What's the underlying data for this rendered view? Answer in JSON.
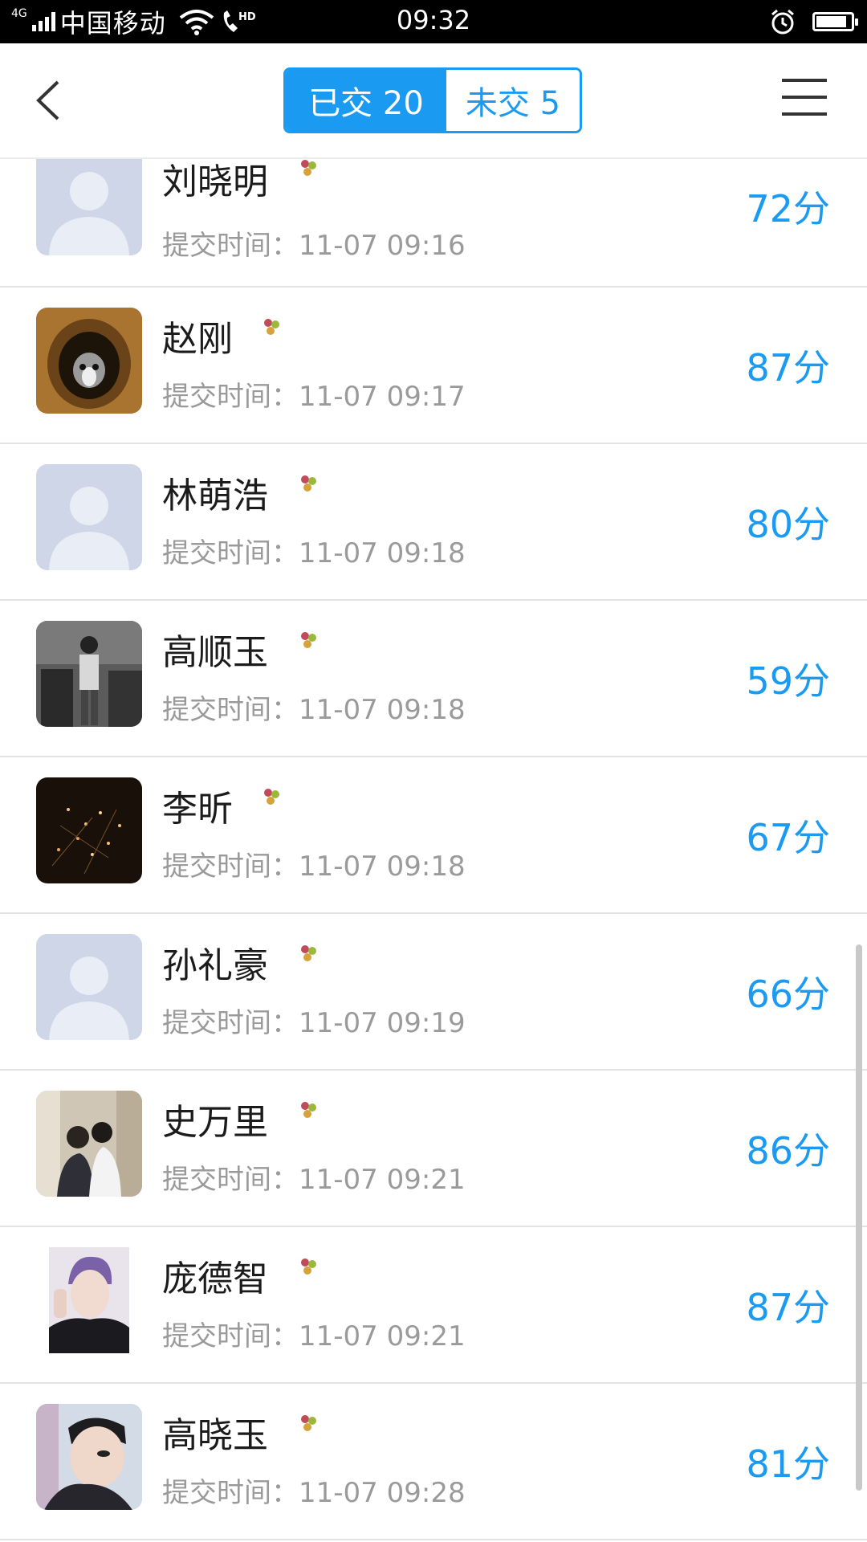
{
  "status_bar": {
    "network": "4G",
    "carrier": "中国移动",
    "time": "09:32"
  },
  "header": {
    "tabs": [
      {
        "label": "已交 20",
        "active": true
      },
      {
        "label": "未交 5",
        "active": false
      }
    ]
  },
  "colors": {
    "accent": "#1a9af0",
    "name_text": "#1b1b1b",
    "time_text": "#9a9a9a"
  },
  "students": [
    {
      "name": "刘晓明",
      "time": "提交时间：11-07 09:16",
      "score": "72分",
      "avatar": "default"
    },
    {
      "name": "赵刚",
      "time": "提交时间：11-07 09:17",
      "score": "87分",
      "avatar": "cat"
    },
    {
      "name": "林萌浩",
      "time": "提交时间：11-07 09:18",
      "score": "80分",
      "avatar": "default"
    },
    {
      "name": "高顺玉",
      "time": "提交时间：11-07 09:18",
      "score": "59分",
      "avatar": "photo-bw"
    },
    {
      "name": "李昕",
      "time": "提交时间：11-07 09:18",
      "score": "67分",
      "avatar": "sparkle"
    },
    {
      "name": "孙礼豪",
      "time": "提交时间：11-07 09:19",
      "score": "66分",
      "avatar": "default"
    },
    {
      "name": "史万里",
      "time": "提交时间：11-07 09:21",
      "score": "86分",
      "avatar": "couple"
    },
    {
      "name": "庞德智",
      "time": "提交时间：11-07 09:21",
      "score": "87分",
      "avatar": "portrait"
    },
    {
      "name": "高晓玉",
      "time": "提交时间：11-07 09:28",
      "score": "81分",
      "avatar": "selfie"
    }
  ]
}
